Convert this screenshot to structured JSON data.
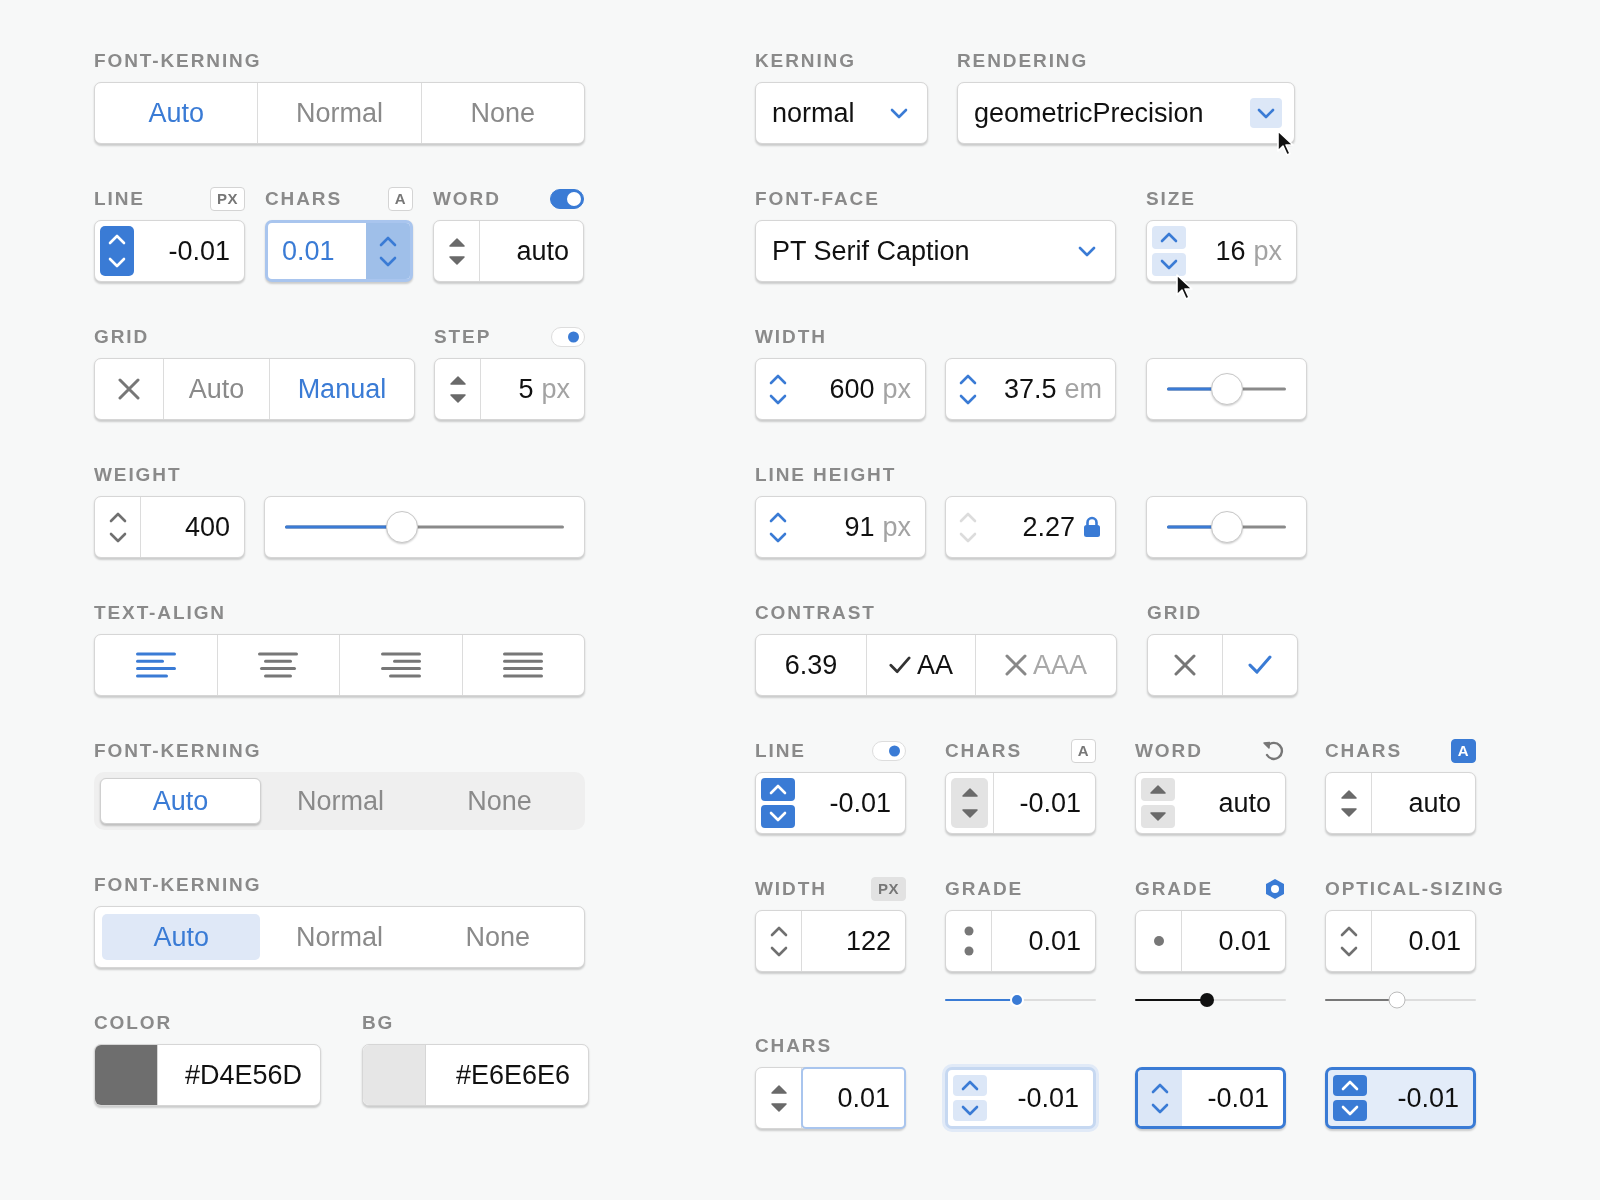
{
  "left": {
    "kerning_bordered": {
      "label": "FONT-KERNING",
      "options": [
        {
          "label": "Auto",
          "selected": true
        },
        {
          "label": "Normal",
          "selected": false
        },
        {
          "label": "None",
          "selected": false
        }
      ]
    },
    "spacing": [
      {
        "label": "LINE",
        "accessory": {
          "kind": "badge",
          "text": "PX"
        },
        "stepper": {
          "kind": "solid"
        },
        "value": "-0.01",
        "kind": "normal"
      },
      {
        "label": "CHARS",
        "accessory": {
          "kind": "badge",
          "text": "A"
        },
        "stepper": {
          "kind": "trailing"
        },
        "value": "0.01",
        "kind": "editing"
      },
      {
        "label": "WORD",
        "accessory": {
          "kind": "toggle",
          "on": true
        },
        "stepper": {
          "kind": "triangles"
        },
        "value": "auto",
        "kind": "normal"
      }
    ],
    "grid": {
      "label": "GRID",
      "options": [
        {
          "kind": "clear",
          "selected": false
        },
        {
          "kind": "text",
          "label": "Auto",
          "selected": false
        },
        {
          "kind": "text",
          "label": "Manual",
          "selected": true
        }
      ]
    },
    "step": {
      "label": "STEP",
      "accessory": {
        "kind": "toggle-light",
        "on": true
      },
      "stepper": {
        "kind": "triangles"
      },
      "value": "5",
      "unit": "px",
      "kind": "normal"
    },
    "weight": {
      "label": "WEIGHT",
      "field": {
        "stepper": {
          "kind": "chevrons"
        },
        "value": "400",
        "kind": "normal"
      },
      "level": 0.42
    },
    "text_align": {
      "label": "TEXT-ALIGN",
      "options": [
        {
          "kind": "left",
          "selected": true
        },
        {
          "kind": "center",
          "selected": false
        },
        {
          "kind": "right",
          "selected": false
        },
        {
          "kind": "justify",
          "selected": false
        }
      ]
    },
    "kerning_pill": {
      "label": "FONT-KERNING",
      "options": [
        {
          "label": "Auto",
          "selected": true
        },
        {
          "label": "Normal",
          "selected": false
        },
        {
          "label": "None",
          "selected": false
        }
      ]
    },
    "kerning_tint": {
      "label": "FONT-KERNING",
      "options": [
        {
          "label": "Auto",
          "selected": true
        },
        {
          "label": "Normal",
          "selected": false
        },
        {
          "label": "None",
          "selected": false
        }
      ]
    },
    "colors": [
      {
        "label": "COLOR",
        "value": "#D4E56D",
        "color": "#6e6e6e"
      },
      {
        "label": "BG",
        "value": "#E6E6E6",
        "color": "#e6e6e6"
      }
    ]
  },
  "right": {
    "kerning": {
      "label": "KERNING",
      "value": "normal",
      "hovered": false
    },
    "rendering": {
      "label": "RENDERING",
      "value": "geometricPrecision",
      "hovered": true
    },
    "font_face": {
      "label": "FONT-FACE",
      "value": "PT Serif Caption",
      "hovered": false
    },
    "size": {
      "label": "SIZE",
      "stepper": {
        "kind": "chevrons-tinted"
      },
      "value": "16",
      "unit": "px",
      "kind": "normal",
      "hovered": true
    },
    "width": {
      "label": "WIDTH",
      "fields": [
        {
          "stepper": {
            "kind": "chevrons-blue"
          },
          "value": "600",
          "unit": "px",
          "kind": "normal"
        },
        {
          "stepper": {
            "kind": "chevrons-blue"
          },
          "value": "37.5",
          "unit": "em",
          "kind": "normal"
        }
      ],
      "level": 0.5
    },
    "line_height": {
      "label": "LINE HEIGHT",
      "fields": [
        {
          "stepper": {
            "kind": "chevrons-blue"
          },
          "value": "91",
          "unit": "px",
          "kind": "normal"
        },
        {
          "stepper": {
            "kind": "chevrons-faint"
          },
          "value": "2.27",
          "locked": true,
          "kind": "normal"
        }
      ],
      "level": 0.5
    },
    "contrast": {
      "label": "CONTRAST",
      "ratio": "6.39",
      "checks": [
        {
          "label": "AA",
          "passed": true
        },
        {
          "label": "AAA",
          "passed": false
        }
      ]
    },
    "grid": {
      "label": "GRID",
      "options": [
        {
          "kind": "clear",
          "selected": false
        },
        {
          "kind": "check",
          "selected": true
        }
      ]
    },
    "spacing": [
      {
        "label": "LINE",
        "accessory": {
          "kind": "toggle-light",
          "on": true
        },
        "stepper": {
          "kind": "solid-split"
        },
        "value": "-0.01",
        "kind": "normal"
      },
      {
        "label": "CHARS",
        "accessory": {
          "kind": "badge",
          "text": "A"
        },
        "stepper": {
          "kind": "triangles-block"
        },
        "value": "-0.01",
        "kind": "normal"
      },
      {
        "label": "WORD",
        "accessory": {
          "kind": "reset"
        },
        "stepper": {
          "kind": "triangles-split"
        },
        "value": "auto",
        "kind": "normal"
      },
      {
        "label": "CHARS",
        "accessory": {
          "kind": "badge-blue",
          "text": "A"
        },
        "stepper": {
          "kind": "triangles"
        },
        "value": "auto",
        "kind": "normal"
      }
    ],
    "axes": [
      {
        "label": "WIDTH",
        "accessory": {
          "kind": "badge-grey",
          "text": "PX"
        },
        "stepper": {
          "kind": "chevrons"
        },
        "value": "122",
        "kind": "normal"
      },
      {
        "label": "GRADE",
        "stepper": {
          "kind": "dots"
        },
        "value": "0.01",
        "kind": "normal",
        "slider": {
          "kind": "blue",
          "level": 0.48
        }
      },
      {
        "label": "GRADE",
        "accessory": {
          "kind": "hexagon"
        },
        "stepper": {
          "kind": "dot"
        },
        "value": "0.01",
        "kind": "normal",
        "slider": {
          "kind": "black",
          "level": 0.48
        }
      },
      {
        "label": "OPTICAL-SIZING",
        "stepper": {
          "kind": "chevrons"
        },
        "value": "0.01",
        "kind": "normal",
        "slider": {
          "kind": "grey",
          "level": 0.48
        }
      }
    ],
    "chars": {
      "label": "CHARS",
      "fields": [
        {
          "stepper": {
            "kind": "triangles"
          },
          "value": "0.01",
          "kind": "input-focus"
        },
        {
          "stepper": {
            "kind": "chevrons-tinted"
          },
          "value": "-0.01",
          "kind": "hover"
        },
        {
          "stepper": {
            "kind": "tinted-column"
          },
          "value": "-0.01",
          "kind": "focus"
        },
        {
          "stepper": {
            "kind": "solid-split"
          },
          "value": "-0.01",
          "kind": "active"
        }
      ]
    }
  }
}
